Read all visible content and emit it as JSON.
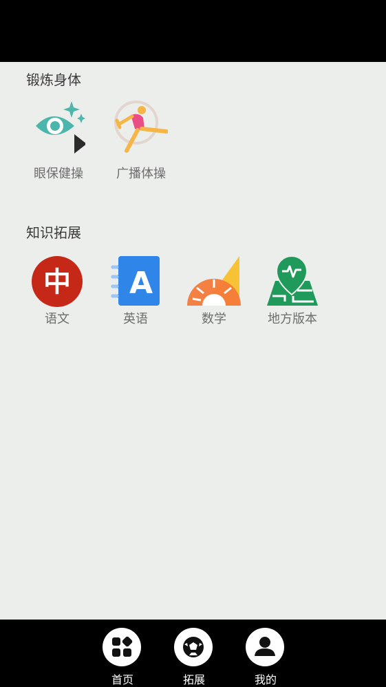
{
  "sections": {
    "exercise": {
      "title": "锻炼身体",
      "items": [
        {
          "label": "眼保健操",
          "icon": "eye-exercise-icon"
        },
        {
          "label": "广播体操",
          "icon": "gymnastics-icon"
        }
      ]
    },
    "knowledge": {
      "title": "知识拓展",
      "items": [
        {
          "label": "语文",
          "icon": "chinese-char-icon"
        },
        {
          "label": "英语",
          "icon": "english-book-icon"
        },
        {
          "label": "数学",
          "icon": "math-ruler-icon"
        },
        {
          "label": "地方版本",
          "icon": "local-map-pin-icon"
        }
      ]
    }
  },
  "icon_glyphs": {
    "chinese": "中",
    "english": "A"
  },
  "bottom_nav": [
    {
      "label": "首页",
      "icon": "home-grid-icon"
    },
    {
      "label": "拓展",
      "icon": "soccer-ball-icon"
    },
    {
      "label": "我的",
      "icon": "user-icon"
    }
  ],
  "colors": {
    "background": "#eceeeb",
    "bars": "#000000",
    "eye_teal": "#4db6ac",
    "chinese_red": "#c62818",
    "english_blue": "#2f86e8",
    "math_orange": "#f47a3a",
    "math_yellow": "#f7c236",
    "map_green": "#1f9a5a"
  }
}
